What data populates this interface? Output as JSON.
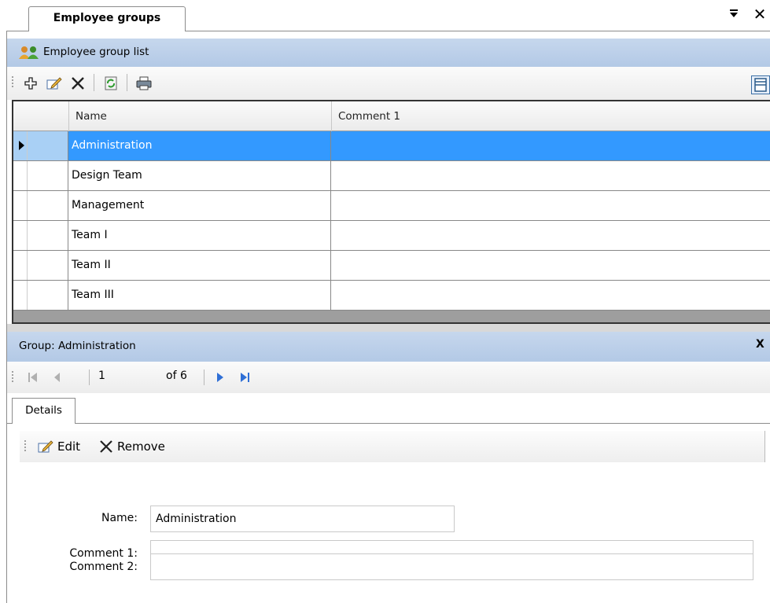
{
  "tab": {
    "title": "Employee groups"
  },
  "list": {
    "title": "Employee group list",
    "columns": [
      "Name",
      "Comment 1"
    ],
    "rows": [
      {
        "name": "Administration",
        "comment1": ""
      },
      {
        "name": "Design Team",
        "comment1": ""
      },
      {
        "name": "Management",
        "comment1": ""
      },
      {
        "name": "Team I",
        "comment1": ""
      },
      {
        "name": "Team II",
        "comment1": ""
      },
      {
        "name": "Team III",
        "comment1": ""
      }
    ],
    "selected_row": 0
  },
  "toolbar": {
    "icons": [
      "add-icon",
      "edit-icon",
      "delete-icon",
      "refresh-icon",
      "print-icon",
      "layout-icon"
    ]
  },
  "detail": {
    "title": "Group: Administration",
    "close_label": "X",
    "navigator": {
      "position": "1",
      "of_label": "of 6"
    },
    "tab_label": "Details",
    "edit_label": "Edit",
    "remove_label": "Remove",
    "form": {
      "name_label": "Name:",
      "name_value": "Administration",
      "comment1_label": "Comment 1:",
      "comment1_value": "",
      "comment2_label": "Comment 2:",
      "comment2_value": ""
    }
  },
  "colors": {
    "header_blue": "#b9cde8",
    "selection": "#3399ff"
  }
}
